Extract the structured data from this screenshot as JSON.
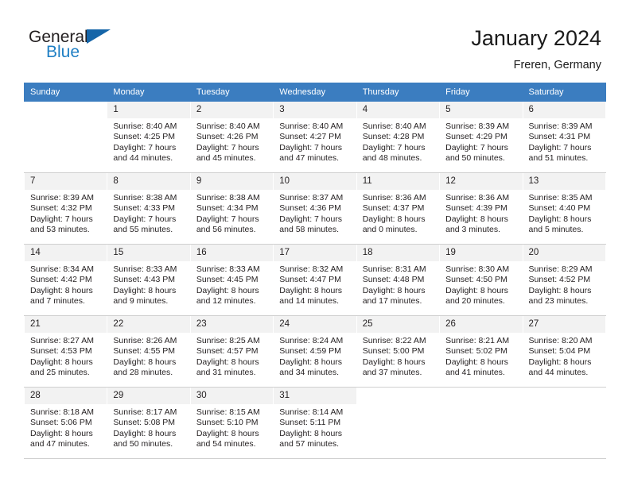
{
  "brand": {
    "name_part1": "General",
    "name_part2": "Blue",
    "logo_icon": "triangle-logo-icon"
  },
  "header": {
    "title": "January 2024",
    "location": "Freren, Germany"
  },
  "calendar": {
    "weekday_headers": [
      "Sunday",
      "Monday",
      "Tuesday",
      "Wednesday",
      "Thursday",
      "Friday",
      "Saturday"
    ],
    "header_bg_color": "#3b7dc0",
    "daynum_bg_color": "#f2f2f2",
    "weeks": [
      [
        {
          "day": "",
          "sunrise": "",
          "sunset": "",
          "daylight_line1": "",
          "daylight_line2": "",
          "empty": true
        },
        {
          "day": "1",
          "sunrise": "Sunrise: 8:40 AM",
          "sunset": "Sunset: 4:25 PM",
          "daylight_line1": "Daylight: 7 hours",
          "daylight_line2": "and 44 minutes."
        },
        {
          "day": "2",
          "sunrise": "Sunrise: 8:40 AM",
          "sunset": "Sunset: 4:26 PM",
          "daylight_line1": "Daylight: 7 hours",
          "daylight_line2": "and 45 minutes."
        },
        {
          "day": "3",
          "sunrise": "Sunrise: 8:40 AM",
          "sunset": "Sunset: 4:27 PM",
          "daylight_line1": "Daylight: 7 hours",
          "daylight_line2": "and 47 minutes."
        },
        {
          "day": "4",
          "sunrise": "Sunrise: 8:40 AM",
          "sunset": "Sunset: 4:28 PM",
          "daylight_line1": "Daylight: 7 hours",
          "daylight_line2": "and 48 minutes."
        },
        {
          "day": "5",
          "sunrise": "Sunrise: 8:39 AM",
          "sunset": "Sunset: 4:29 PM",
          "daylight_line1": "Daylight: 7 hours",
          "daylight_line2": "and 50 minutes."
        },
        {
          "day": "6",
          "sunrise": "Sunrise: 8:39 AM",
          "sunset": "Sunset: 4:31 PM",
          "daylight_line1": "Daylight: 7 hours",
          "daylight_line2": "and 51 minutes."
        }
      ],
      [
        {
          "day": "7",
          "sunrise": "Sunrise: 8:39 AM",
          "sunset": "Sunset: 4:32 PM",
          "daylight_line1": "Daylight: 7 hours",
          "daylight_line2": "and 53 minutes."
        },
        {
          "day": "8",
          "sunrise": "Sunrise: 8:38 AM",
          "sunset": "Sunset: 4:33 PM",
          "daylight_line1": "Daylight: 7 hours",
          "daylight_line2": "and 55 minutes."
        },
        {
          "day": "9",
          "sunrise": "Sunrise: 8:38 AM",
          "sunset": "Sunset: 4:34 PM",
          "daylight_line1": "Daylight: 7 hours",
          "daylight_line2": "and 56 minutes."
        },
        {
          "day": "10",
          "sunrise": "Sunrise: 8:37 AM",
          "sunset": "Sunset: 4:36 PM",
          "daylight_line1": "Daylight: 7 hours",
          "daylight_line2": "and 58 minutes."
        },
        {
          "day": "11",
          "sunrise": "Sunrise: 8:36 AM",
          "sunset": "Sunset: 4:37 PM",
          "daylight_line1": "Daylight: 8 hours",
          "daylight_line2": "and 0 minutes."
        },
        {
          "day": "12",
          "sunrise": "Sunrise: 8:36 AM",
          "sunset": "Sunset: 4:39 PM",
          "daylight_line1": "Daylight: 8 hours",
          "daylight_line2": "and 3 minutes."
        },
        {
          "day": "13",
          "sunrise": "Sunrise: 8:35 AM",
          "sunset": "Sunset: 4:40 PM",
          "daylight_line1": "Daylight: 8 hours",
          "daylight_line2": "and 5 minutes."
        }
      ],
      [
        {
          "day": "14",
          "sunrise": "Sunrise: 8:34 AM",
          "sunset": "Sunset: 4:42 PM",
          "daylight_line1": "Daylight: 8 hours",
          "daylight_line2": "and 7 minutes."
        },
        {
          "day": "15",
          "sunrise": "Sunrise: 8:33 AM",
          "sunset": "Sunset: 4:43 PM",
          "daylight_line1": "Daylight: 8 hours",
          "daylight_line2": "and 9 minutes."
        },
        {
          "day": "16",
          "sunrise": "Sunrise: 8:33 AM",
          "sunset": "Sunset: 4:45 PM",
          "daylight_line1": "Daylight: 8 hours",
          "daylight_line2": "and 12 minutes."
        },
        {
          "day": "17",
          "sunrise": "Sunrise: 8:32 AM",
          "sunset": "Sunset: 4:47 PM",
          "daylight_line1": "Daylight: 8 hours",
          "daylight_line2": "and 14 minutes."
        },
        {
          "day": "18",
          "sunrise": "Sunrise: 8:31 AM",
          "sunset": "Sunset: 4:48 PM",
          "daylight_line1": "Daylight: 8 hours",
          "daylight_line2": "and 17 minutes."
        },
        {
          "day": "19",
          "sunrise": "Sunrise: 8:30 AM",
          "sunset": "Sunset: 4:50 PM",
          "daylight_line1": "Daylight: 8 hours",
          "daylight_line2": "and 20 minutes."
        },
        {
          "day": "20",
          "sunrise": "Sunrise: 8:29 AM",
          "sunset": "Sunset: 4:52 PM",
          "daylight_line1": "Daylight: 8 hours",
          "daylight_line2": "and 23 minutes."
        }
      ],
      [
        {
          "day": "21",
          "sunrise": "Sunrise: 8:27 AM",
          "sunset": "Sunset: 4:53 PM",
          "daylight_line1": "Daylight: 8 hours",
          "daylight_line2": "and 25 minutes."
        },
        {
          "day": "22",
          "sunrise": "Sunrise: 8:26 AM",
          "sunset": "Sunset: 4:55 PM",
          "daylight_line1": "Daylight: 8 hours",
          "daylight_line2": "and 28 minutes."
        },
        {
          "day": "23",
          "sunrise": "Sunrise: 8:25 AM",
          "sunset": "Sunset: 4:57 PM",
          "daylight_line1": "Daylight: 8 hours",
          "daylight_line2": "and 31 minutes."
        },
        {
          "day": "24",
          "sunrise": "Sunrise: 8:24 AM",
          "sunset": "Sunset: 4:59 PM",
          "daylight_line1": "Daylight: 8 hours",
          "daylight_line2": "and 34 minutes."
        },
        {
          "day": "25",
          "sunrise": "Sunrise: 8:22 AM",
          "sunset": "Sunset: 5:00 PM",
          "daylight_line1": "Daylight: 8 hours",
          "daylight_line2": "and 37 minutes."
        },
        {
          "day": "26",
          "sunrise": "Sunrise: 8:21 AM",
          "sunset": "Sunset: 5:02 PM",
          "daylight_line1": "Daylight: 8 hours",
          "daylight_line2": "and 41 minutes."
        },
        {
          "day": "27",
          "sunrise": "Sunrise: 8:20 AM",
          "sunset": "Sunset: 5:04 PM",
          "daylight_line1": "Daylight: 8 hours",
          "daylight_line2": "and 44 minutes."
        }
      ],
      [
        {
          "day": "28",
          "sunrise": "Sunrise: 8:18 AM",
          "sunset": "Sunset: 5:06 PM",
          "daylight_line1": "Daylight: 8 hours",
          "daylight_line2": "and 47 minutes."
        },
        {
          "day": "29",
          "sunrise": "Sunrise: 8:17 AM",
          "sunset": "Sunset: 5:08 PM",
          "daylight_line1": "Daylight: 8 hours",
          "daylight_line2": "and 50 minutes."
        },
        {
          "day": "30",
          "sunrise": "Sunrise: 8:15 AM",
          "sunset": "Sunset: 5:10 PM",
          "daylight_line1": "Daylight: 8 hours",
          "daylight_line2": "and 54 minutes."
        },
        {
          "day": "31",
          "sunrise": "Sunrise: 8:14 AM",
          "sunset": "Sunset: 5:11 PM",
          "daylight_line1": "Daylight: 8 hours",
          "daylight_line2": "and 57 minutes."
        },
        {
          "day": "",
          "sunrise": "",
          "sunset": "",
          "daylight_line1": "",
          "daylight_line2": "",
          "empty": true
        },
        {
          "day": "",
          "sunrise": "",
          "sunset": "",
          "daylight_line1": "",
          "daylight_line2": "",
          "empty": true
        },
        {
          "day": "",
          "sunrise": "",
          "sunset": "",
          "daylight_line1": "",
          "daylight_line2": "",
          "empty": true
        }
      ]
    ]
  }
}
